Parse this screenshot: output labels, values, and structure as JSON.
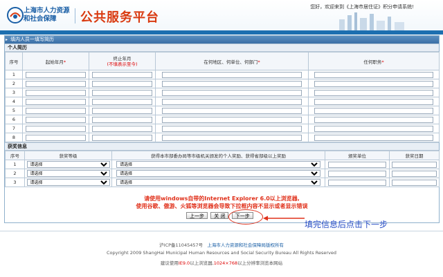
{
  "header": {
    "logo_line1": "上海市人力资源",
    "logo_line2": "和社会保障",
    "site_title": "公共服务平台",
    "welcome": "您好，欢迎来到《上海市居住证》积分申请系统!"
  },
  "panel": {
    "title": "填内人员一填写简历",
    "resume_section": "个人简历",
    "resume_headers": {
      "index": "序号",
      "start": "起始年月",
      "end": "终止年月",
      "end_note": "(不填表示至今)",
      "org": "在何地区、何单位、何部门",
      "position": "任何职务"
    },
    "resume_rows": [
      "1",
      "2",
      "3",
      "4",
      "5",
      "6",
      "7",
      "8"
    ],
    "award_section": "获奖信息",
    "award_headers": {
      "index": "序号",
      "level": "获奖等级",
      "award": "获得本市部委办局等市级机关颁发的个人奖励、获得省部级以上奖励",
      "unit": "颁奖单位",
      "date": "获奖日期"
    },
    "award_rows": [
      "1",
      "2",
      "3"
    ],
    "select_placeholder": "请选择",
    "warning_line1": "请使用windows自带的Internet Explorer 6.0以上浏览器,",
    "warning_line2": "使用谷歌、傲游、火狐等浏览器会导致下拉框内容不显示或者显示错误",
    "buttons": {
      "prev": "上一步",
      "close": "关 闭",
      "next": "下一步"
    }
  },
  "annotation": "填完信息后点击下一步",
  "footer": {
    "icp": "沪ICP备11045457号",
    "owner": "上海市人力资源和社会保障局版权所有",
    "copyright": "Copyright 2009 ShangHai Municipal Human Resources and Social Security Bureau All Rights Reserved",
    "advice_prefix": "建议使用",
    "advice_ie": "IE9.0",
    "advice_mid": "以上浏览器,",
    "advice_res": "1024×768",
    "advice_suffix": "以上分辨率浏览本网站"
  },
  "colors": {
    "brand_blue": "#1a5fa6",
    "title_orange": "#d93a10",
    "warning_red": "#e0301a",
    "annotation_blue": "#2a4fc6"
  }
}
